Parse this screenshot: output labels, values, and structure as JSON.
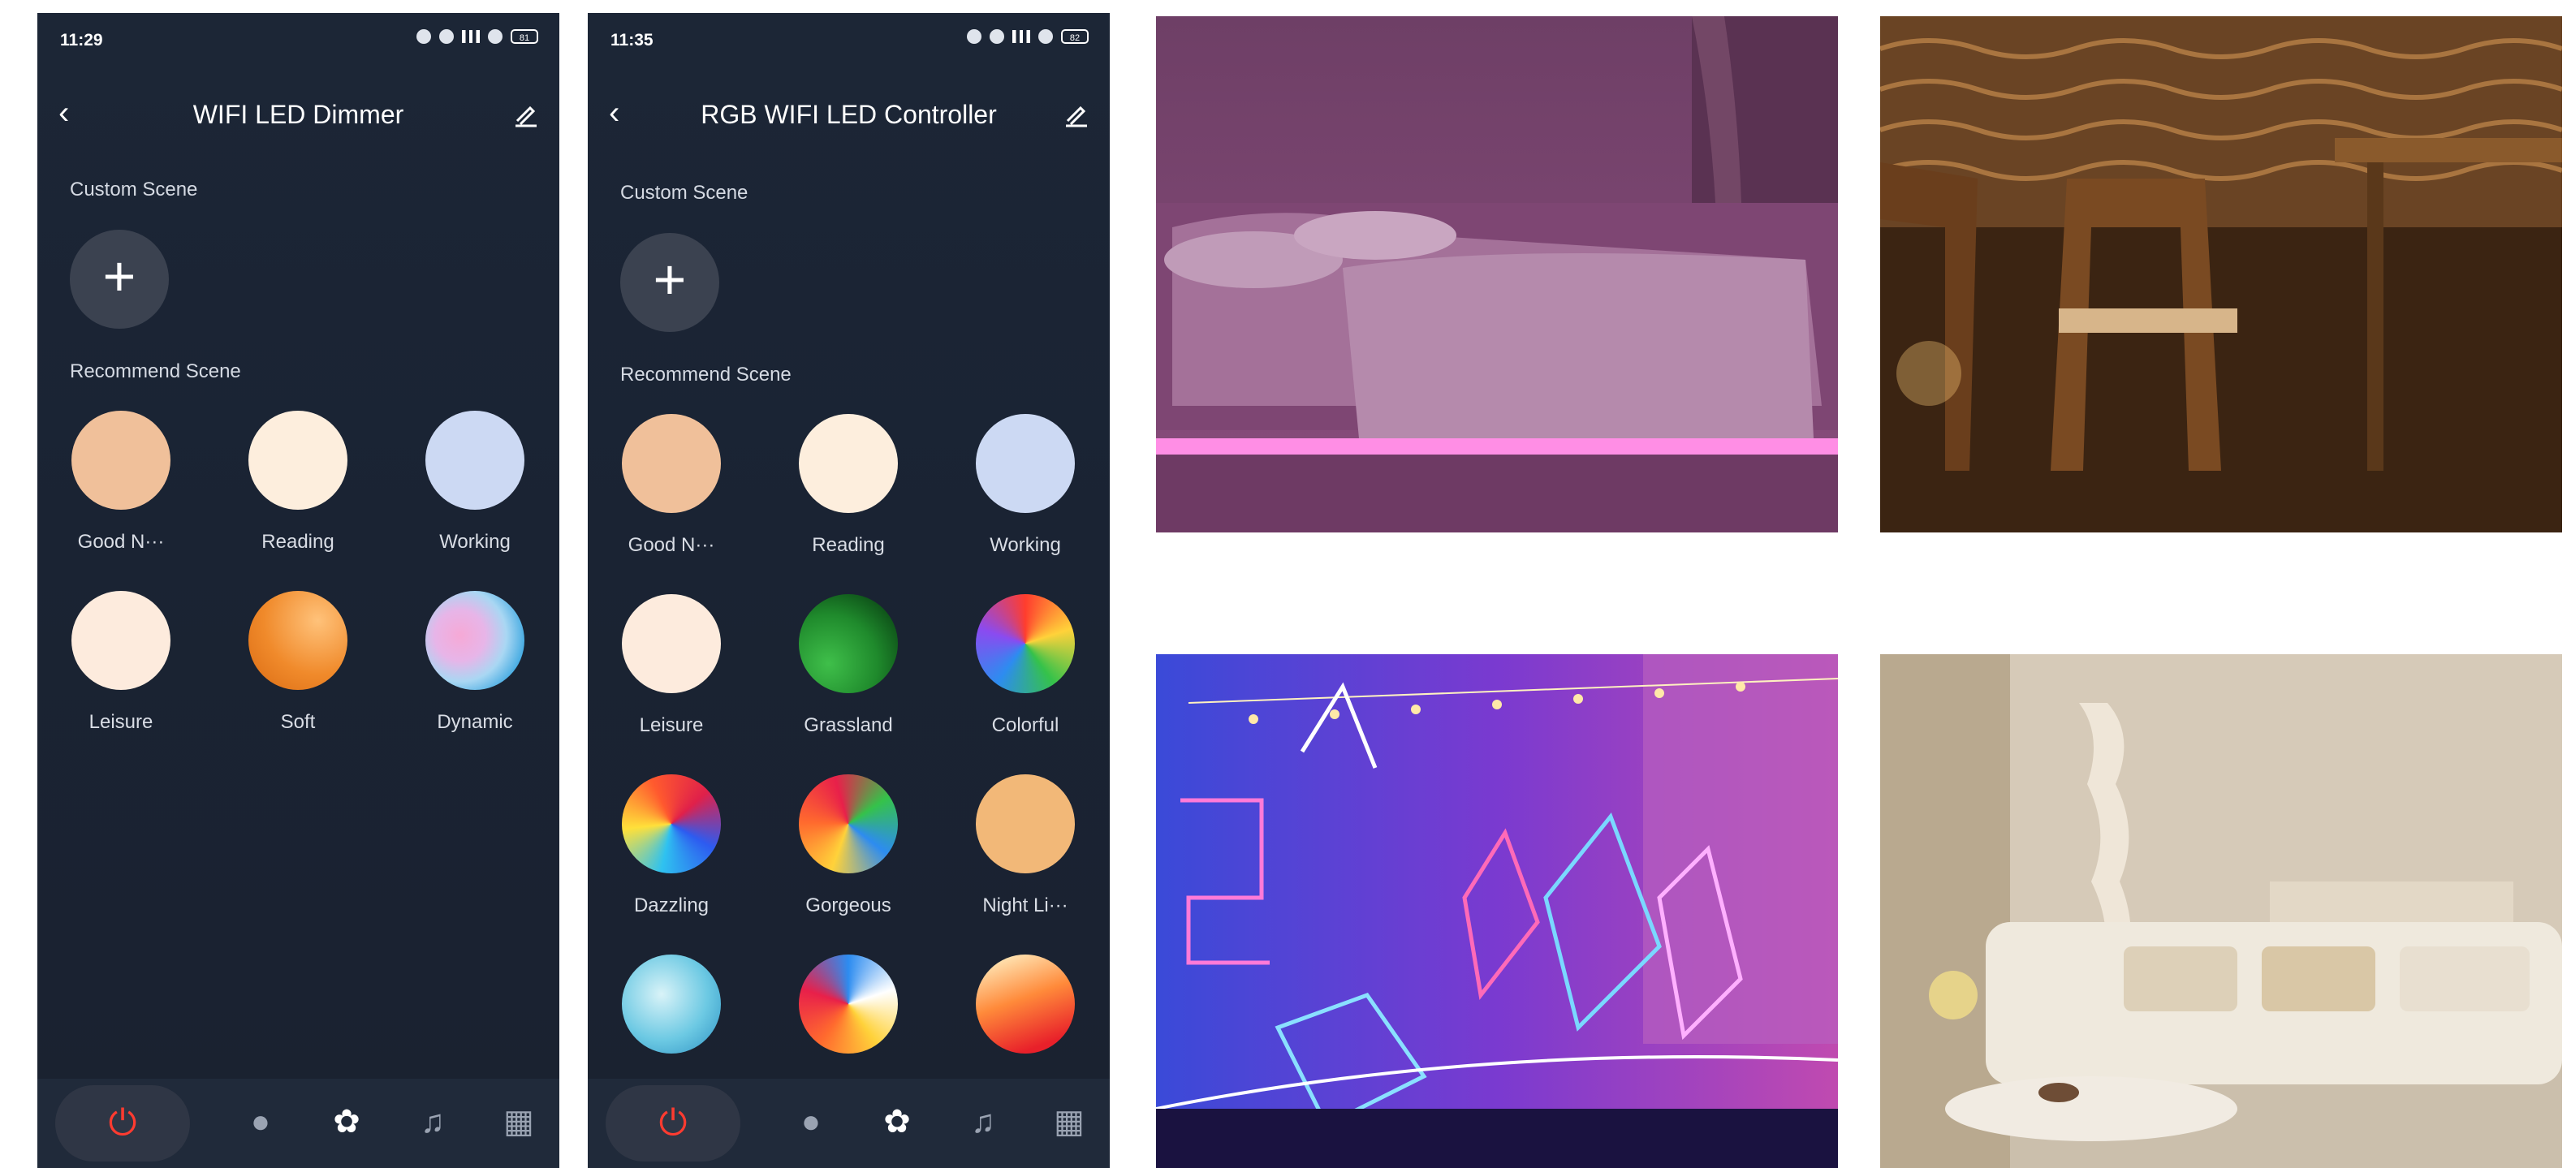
{
  "phone1": {
    "status": {
      "time": "11:29",
      "battery": "81"
    },
    "title": "WIFI LED Dimmer",
    "custom_scene_label": "Custom Scene",
    "recommend_scene_label": "Recommend Scene",
    "add_label": "+",
    "scenes": [
      {
        "label": "Good N···",
        "color": "#f0c09a"
      },
      {
        "label": "Reading",
        "color": "#fdeedd"
      },
      {
        "label": "Working",
        "color": "#ccd9f3"
      },
      {
        "label": "Leisure",
        "color": "#fdebdd"
      },
      {
        "label": "Soft",
        "color": "#f08a2b"
      },
      {
        "label": "Dynamic",
        "color": "gradient-pink-blue"
      }
    ]
  },
  "phone2": {
    "status": {
      "time": "11:35",
      "battery": "82"
    },
    "title": "RGB WIFI LED Controller",
    "custom_scene_label": "Custom Scene",
    "recommend_scene_label": "Recommend Scene",
    "add_label": "+",
    "scenes": [
      {
        "label": "Good N···",
        "color": "#f0c09a"
      },
      {
        "label": "Reading",
        "color": "#fdeedd"
      },
      {
        "label": "Working",
        "color": "#ccd9f3"
      },
      {
        "label": "Leisure",
        "color": "#fdebdd"
      },
      {
        "label": "Grassland",
        "color": "gradient-green"
      },
      {
        "label": "Colorful",
        "color": "gradient-rainbow"
      },
      {
        "label": "Dazzling",
        "color": "gradient-rainbow-2"
      },
      {
        "label": "Gorgeous",
        "color": "gradient-rainbow-3"
      },
      {
        "label": "Night Li···",
        "color": "#f2b878"
      },
      {
        "label": "",
        "color": "gradient-cyan"
      },
      {
        "label": "",
        "color": "gradient-multi"
      },
      {
        "label": "",
        "color": "gradient-red-orange"
      }
    ]
  },
  "bottom_tabs": [
    "power-icon",
    "bulb-icon",
    "palette-icon",
    "music-icon",
    "grid-icon"
  ],
  "photos": [
    "bedroom-pink-led",
    "dining-warm-light",
    "neon-party-stage",
    "living-room-neutral"
  ]
}
